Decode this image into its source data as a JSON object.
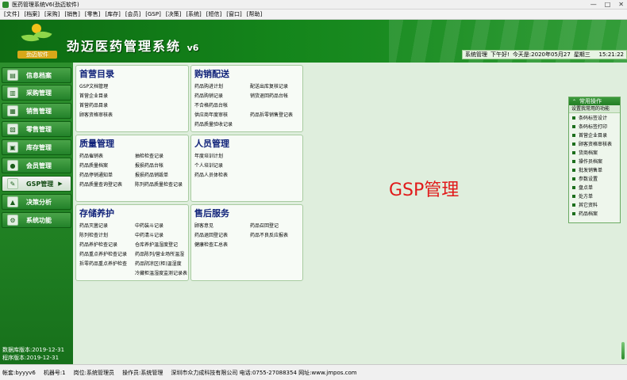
{
  "window": {
    "title": "医药管理系统V6(劲迈软件)",
    "minimize": "—",
    "maximize": "□",
    "close": "✕"
  },
  "menu": [
    "[文件]",
    "[档案]",
    "[采购]",
    "[销售]",
    "[零售]",
    "[库存]",
    "[会员]",
    "[GSP]",
    "[决策]",
    "[系统]",
    "[短信]",
    "[窗口]",
    "[帮助]"
  ],
  "header": {
    "logo_text": "劲迈软件",
    "app_title": "劲迈医药管理系统",
    "version": "v6",
    "status_user": "系统管理",
    "status_greeting": "下午好!",
    "status_date": "今天是:2020年05月27",
    "status_weekday": "星期三",
    "status_time": "15:21:22"
  },
  "sidebar": {
    "items": [
      {
        "label": "信息档案",
        "icon": "id-card-icon"
      },
      {
        "label": "采购管理",
        "icon": "cart-icon"
      },
      {
        "label": "销售管理",
        "icon": "cash-register-icon"
      },
      {
        "label": "零售管理",
        "icon": "cashier-icon"
      },
      {
        "label": "库存管理",
        "icon": "warehouse-icon"
      },
      {
        "label": "会员管理",
        "icon": "members-icon"
      },
      {
        "label": "GSP管理",
        "icon": "gsp-icon"
      },
      {
        "label": "决策分析",
        "icon": "chart-icon"
      },
      {
        "label": "系统功能",
        "icon": "gear-icon"
      }
    ],
    "data_version": "数据库版本:2019-12-31",
    "program_version": "程序版本:2019-12-31"
  },
  "panels": {
    "p1": {
      "title": "首营目录",
      "links": [
        "GSP文档管理",
        "首营企业目录",
        "首营药品目录",
        "顾客资格审核表"
      ]
    },
    "p2": {
      "title": "购销配送",
      "links": [
        "药品购进计划",
        "配送出库复核记录",
        "药品购销记录",
        "销货退回药品台帐",
        "不合格药品台帐",
        "供应商年度审核",
        "药品拆零销售登记表",
        "药品质量验收记录"
      ]
    },
    "p3": {
      "title": "质量管理",
      "links": [
        "药品催销表",
        "抽检检查记录",
        "药品质量档案",
        "报损药品台帐",
        "药品停销通知单",
        "报损药品销毁单",
        "药品质量查询登记表",
        "陈列药品质量检查记录"
      ]
    },
    "p4": {
      "title": "人员管理",
      "links": [
        "年度培训计划",
        "个人培训记录",
        "药品人员体检表"
      ]
    },
    "p5": {
      "title": "存储养护",
      "links": [
        "药品灭菌记录",
        "中药装斗记录",
        "陈列检查计划",
        "中药清斗记录",
        "药品养护检查记录",
        "仓库养护温湿度登记",
        "药品重点养护检查记录",
        "药品陈列/营业场所温湿",
        "拆零药品重点养护检查",
        "药品阴凉区(柜)温湿度",
        "冷藏柜温湿度监测记录表"
      ]
    },
    "p6": {
      "title": "售后服务",
      "links": [
        "顾客意见",
        "药品召回登记",
        "药品退回登记表",
        "药品不良反应报表",
        "健康检查汇总表"
      ]
    }
  },
  "main_label": "GSP管理",
  "quick_ops": {
    "title": "常用操作",
    "subtitle": "设置我常用的功能",
    "items": [
      "条码标签设计",
      "条码标签打印",
      "首营企业目录",
      "顾客资格审核表",
      "货商档案",
      "操作员档案",
      "批发销售单",
      "参数设置",
      "盘点单",
      "处方单",
      "其它资料",
      "药品档案"
    ]
  },
  "statusbar": {
    "account": "帐套:byyyv6",
    "machine": "机器号:1",
    "position": "岗位:系统管理员",
    "operator": "操作员:系统管理",
    "company": "深圳市众力成科技有限公司 电话:0755-27088354 网址:www.jmpos.com"
  },
  "colors": {
    "brand_green": "#14851b",
    "title_blue": "#11237a",
    "accent_red": "#e11a1a"
  }
}
